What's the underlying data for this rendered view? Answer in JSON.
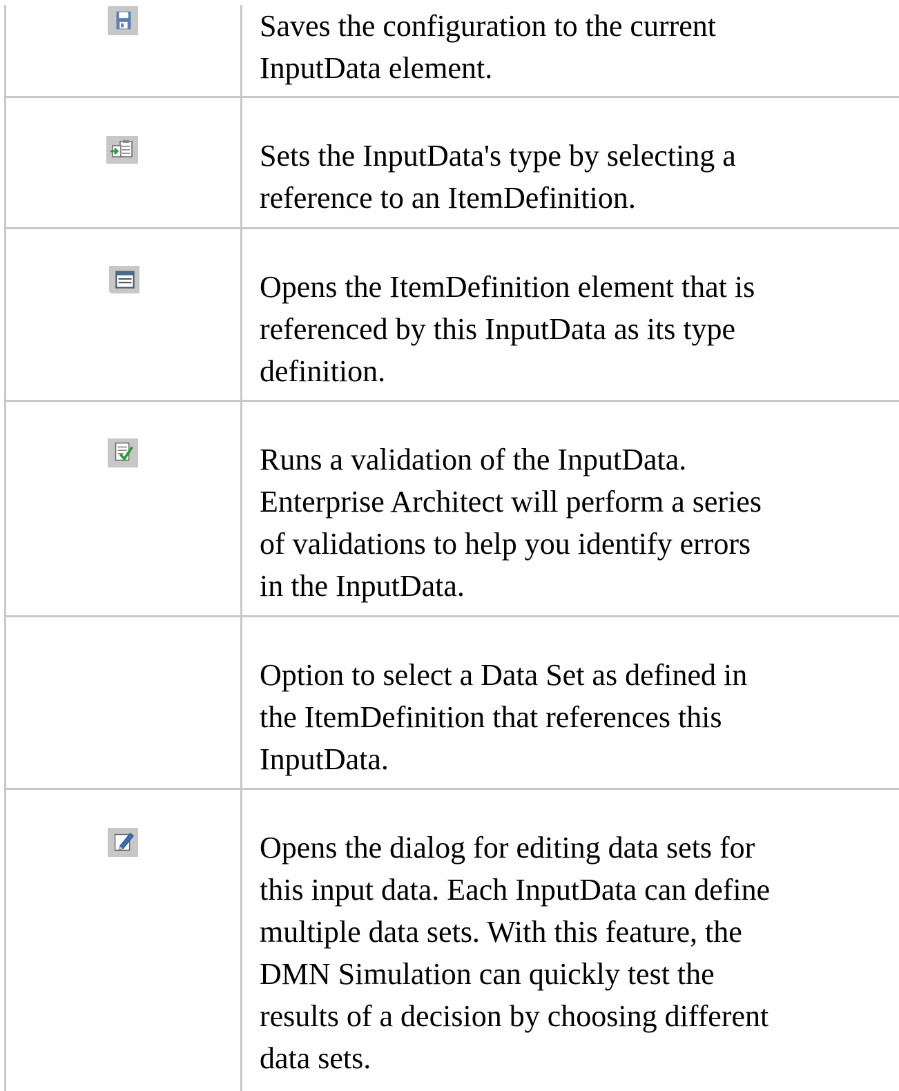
{
  "rows": [
    {
      "icon": "save-icon",
      "description": "Saves the configuration to the current\nInputData element."
    },
    {
      "icon": "set-type-reference-icon",
      "description": "Sets the InputData's type by selecting a\nreference to an ItemDefinition."
    },
    {
      "icon": "open-item-definition-icon",
      "description": "Opens the ItemDefinition element that is\nreferenced by this InputData as its type\ndefinition."
    },
    {
      "icon": "validate-icon",
      "description": "Runs a validation of the InputData.\nEnterprise Architect will perform a series\nof validations to help you identify errors\nin the InputData."
    },
    {
      "icon": "",
      "description": "Option to select a Data Set as defined in\nthe ItemDefinition that references this\nInputData."
    },
    {
      "icon": "edit-data-sets-icon",
      "description": "Opens the dialog for editing data sets for\nthis input data. Each InputData can define\nmultiple data sets. With this feature, the\nDMN Simulation can quickly test the\nresults of a decision by choosing different\ndata sets."
    }
  ]
}
